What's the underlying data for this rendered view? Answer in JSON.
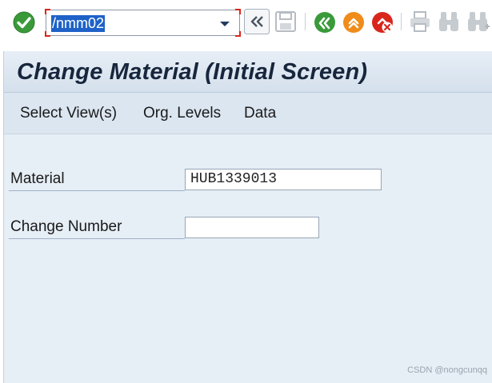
{
  "toolbar": {
    "command_field": {
      "value": "/nmm02",
      "state": "selected"
    },
    "buttons": [
      {
        "name": "enter",
        "icon": "green-check-icon"
      },
      {
        "name": "back",
        "icon": "double-chevron-left-icon"
      },
      {
        "name": "save",
        "icon": "save-icon",
        "state": "disabled"
      },
      {
        "name": "back-green",
        "icon": "back-arrow-icon"
      },
      {
        "name": "exit",
        "icon": "exit-up-icon"
      },
      {
        "name": "cancel",
        "icon": "cancel-x-icon"
      },
      {
        "name": "print",
        "icon": "printer-icon",
        "state": "disabled"
      },
      {
        "name": "find",
        "icon": "binoculars-icon",
        "state": "disabled"
      },
      {
        "name": "find-next",
        "icon": "binoculars-plus-icon",
        "state": "disabled"
      }
    ]
  },
  "page": {
    "title": "Change Material (Initial Screen)"
  },
  "menu": {
    "items": [
      "Select View(s)",
      "Org. Levels",
      "Data"
    ]
  },
  "form": {
    "material": {
      "label": "Material",
      "value": "HUB1339013"
    },
    "change_number": {
      "label": "Change Number",
      "value": ""
    }
  },
  "watermark": "CSDN @nongcunqq",
  "colors": {
    "accent_green": "#3a9a3a",
    "accent_orange": "#f08c1a",
    "accent_red": "#d9261c",
    "title_bar": "#dce6f0",
    "content_bg": "#e6eef6",
    "selection_blue": "#1e62c8"
  }
}
